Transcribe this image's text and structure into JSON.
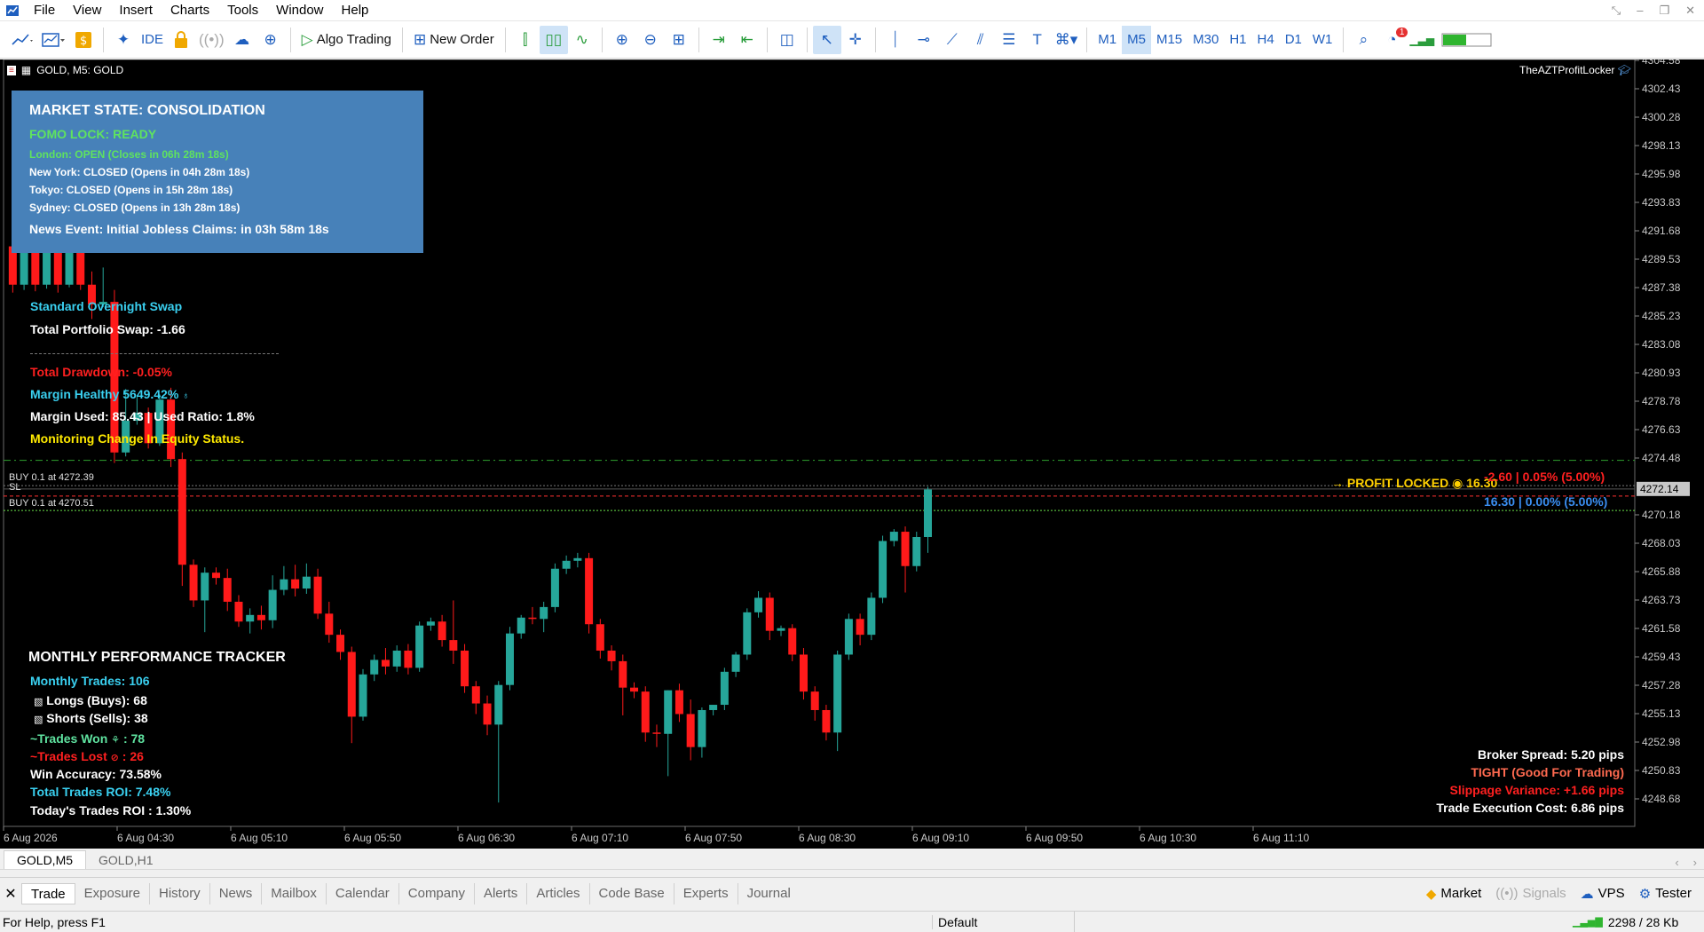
{
  "menu": [
    "File",
    "View",
    "Insert",
    "Charts",
    "Tools",
    "Window",
    "Help"
  ],
  "toolbar": {
    "ide_label": "IDE",
    "algo_label": "Algo Trading",
    "new_order_label": "New Order",
    "timeframes": [
      "M1",
      "M5",
      "M15",
      "M30",
      "H1",
      "H4",
      "D1",
      "W1"
    ],
    "selected_timeframe": "M5",
    "notification_count": "1"
  },
  "chart": {
    "title": "GOLD, M5:  GOLD",
    "ea_name": "TheAZTProfitLocker",
    "price_levels": [
      "4304.58",
      "4302.43",
      "4300.28",
      "4298.13",
      "4295.98",
      "4293.83",
      "4291.68",
      "4289.53",
      "4287.38",
      "4285.23",
      "4283.08",
      "4280.93",
      "4278.78",
      "4276.63",
      "4274.48",
      "4272.14",
      "4270.18",
      "4268.03",
      "4265.88",
      "4263.73",
      "4261.58",
      "4259.43",
      "4257.28",
      "4255.13",
      "4252.98",
      "4250.83",
      "4248.68"
    ],
    "current_price": "4272.14",
    "time_labels": [
      "6 Aug 2026",
      "6 Aug 04:30",
      "6 Aug 05:10",
      "6 Aug 05:50",
      "6 Aug 06:30",
      "6 Aug 07:10",
      "6 Aug 07:50",
      "6 Aug 08:30",
      "6 Aug 09:10",
      "6 Aug 09:50",
      "6 Aug 10:30",
      "6 Aug 11:10"
    ],
    "orders": [
      "BUY 0.1 at 4272.39",
      "SL",
      "BUY 0.1 at 4270.51"
    ],
    "bull_color": "#26a69a",
    "bear_color": "#ff1a1a"
  },
  "market_state": {
    "title": "MARKET STATE: CONSOLIDATION",
    "fomo": "FOMO LOCK: READY",
    "sessions": [
      {
        "text": "London: OPEN (Closes in 06h 28m 18s)",
        "color": "#5fe35f"
      },
      {
        "text": "New York: CLOSED (Opens in 04h 28m 18s)",
        "color": "#ffffff"
      },
      {
        "text": "Tokyo: CLOSED (Opens in 15h 28m 18s)",
        "color": "#ffffff"
      },
      {
        "text": "Sydney: CLOSED (Opens in 13h 28m 18s)",
        "color": "#ffffff"
      }
    ],
    "news": "News Event: Initial Jobless Claims: in 03h 58m 18s"
  },
  "account": {
    "swap_label": "Standard Overnight Swap",
    "total_swap": "Total Portfolio Swap:  -1.66",
    "drawdown": "Total Drawdown: -0.05%",
    "margin_health": "Margin Healthy 5649.42%",
    "margin_used": "Margin Used: 85.43 | Used Ratio: 1.8%",
    "monitoring": "Monitoring Change In Equity Status."
  },
  "profit": {
    "locked_label": "PROFIT LOCKED",
    "locked_value": "16.30",
    "red_line": "-2.60 | 0.05% (5.00%)",
    "blue_line": "16.30 | 0.00% (5.00%)"
  },
  "monthly": {
    "title": "MONTHLY PERFORMANCE TRACKER",
    "trades": "Monthly Trades: 106",
    "longs": "Longs (Buys): 68",
    "shorts": "Shorts (Sells): 38",
    "won": "~Trades Won",
    "won_value": ": 78",
    "lost": "~Trades Lost",
    "lost_value": ": 26",
    "accuracy": "Win Accuracy: 73.58%",
    "roi": "Total Trades ROI: 7.48%",
    "today_roi": "Today's Trades ROI : 1.30%"
  },
  "spread": {
    "broker": "Broker Spread: 5.20 pips",
    "tight": "TIGHT (Good For Trading)",
    "slippage": "Slippage Variance: +1.66 pips",
    "cost": "Trade Execution Cost: 6.86 pips"
  },
  "chart_tabs": [
    "GOLD,M5",
    "GOLD,H1"
  ],
  "toolbox_tabs": [
    "Trade",
    "Exposure",
    "History",
    "News",
    "Mailbox",
    "Calendar",
    "Company",
    "Alerts",
    "Articles",
    "Code Base",
    "Experts",
    "Journal"
  ],
  "toolbox_right": [
    "Market",
    "Signals",
    "VPS",
    "Tester"
  ],
  "status": {
    "help": "For Help, press F1",
    "profile": "Default",
    "traffic": "2298 / 28 Kb"
  },
  "candles": [
    {
      "o": 4290.5,
      "h": 4293.2,
      "c": 4287.6,
      "l": 4287.0
    },
    {
      "o": 4287.6,
      "h": 4290.8,
      "c": 4290.2,
      "l": 4287.2
    },
    {
      "o": 4290.2,
      "h": 4290.6,
      "c": 4287.6,
      "l": 4287.1
    },
    {
      "o": 4287.6,
      "h": 4290.6,
      "c": 4290.1,
      "l": 4287.3
    },
    {
      "o": 4290.1,
      "h": 4291.2,
      "c": 4287.6,
      "l": 4287.0
    },
    {
      "o": 4287.6,
      "h": 4291.0,
      "c": 4290.3,
      "l": 4287.4
    },
    {
      "o": 4290.3,
      "h": 4290.8,
      "c": 4287.6,
      "l": 4287.2
    },
    {
      "o": 4287.6,
      "h": 4288.6,
      "c": 4286.1,
      "l": 4285.0
    },
    {
      "o": 4286.1,
      "h": 4288.9,
      "c": 4286.3,
      "l": 4285.9
    },
    {
      "o": 4286.3,
      "h": 4287.2,
      "c": 4274.9,
      "l": 4274.1
    },
    {
      "o": 4274.9,
      "h": 4279.7,
      "c": 4277.3,
      "l": 4274.6
    },
    {
      "o": 4277.3,
      "h": 4279.2,
      "c": 4277.9,
      "l": 4277.0
    },
    {
      "o": 4277.9,
      "h": 4278.3,
      "c": 4275.6,
      "l": 4275.2
    },
    {
      "o": 4275.6,
      "h": 4279.3,
      "c": 4278.9,
      "l": 4275.4
    },
    {
      "o": 4278.9,
      "h": 4279.8,
      "c": 4274.4,
      "l": 4273.8
    },
    {
      "o": 4274.4,
      "h": 4274.9,
      "c": 4266.4,
      "l": 4264.8
    },
    {
      "o": 4266.4,
      "h": 4266.8,
      "c": 4263.7,
      "l": 4263.2
    },
    {
      "o": 4263.7,
      "h": 4266.2,
      "c": 4265.8,
      "l": 4261.3
    },
    {
      "o": 4265.8,
      "h": 4266.2,
      "c": 4265.4,
      "l": 4264.9
    },
    {
      "o": 4265.4,
      "h": 4266.1,
      "c": 4263.6,
      "l": 4262.9
    },
    {
      "o": 4263.6,
      "h": 4264.1,
      "c": 4262.1,
      "l": 4261.7
    },
    {
      "o": 4262.1,
      "h": 4263.1,
      "c": 4262.6,
      "l": 4261.2
    },
    {
      "o": 4262.6,
      "h": 4263.3,
      "c": 4262.2,
      "l": 4261.5
    },
    {
      "o": 4262.2,
      "h": 4265.6,
      "c": 4264.5,
      "l": 4261.6
    },
    {
      "o": 4264.5,
      "h": 4266.3,
      "c": 4265.3,
      "l": 4264.1
    },
    {
      "o": 4265.3,
      "h": 4266.4,
      "c": 4264.6,
      "l": 4264.0
    },
    {
      "o": 4264.6,
      "h": 4266.5,
      "c": 4265.5,
      "l": 4264.2
    },
    {
      "o": 4265.5,
      "h": 4266.1,
      "c": 4262.7,
      "l": 4262.3
    },
    {
      "o": 4262.7,
      "h": 4263.6,
      "c": 4261.1,
      "l": 4260.5
    },
    {
      "o": 4261.1,
      "h": 4261.5,
      "c": 4259.8,
      "l": 4259.2
    },
    {
      "o": 4259.8,
      "h": 4260.2,
      "c": 4254.9,
      "l": 4252.9
    },
    {
      "o": 4254.9,
      "h": 4258.5,
      "c": 4258.1,
      "l": 4254.6
    },
    {
      "o": 4258.1,
      "h": 4259.6,
      "c": 4259.2,
      "l": 4257.6
    },
    {
      "o": 4259.2,
      "h": 4260.1,
      "c": 4258.7,
      "l": 4258.1
    },
    {
      "o": 4258.7,
      "h": 4260.3,
      "c": 4259.9,
      "l": 4258.3
    },
    {
      "o": 4259.9,
      "h": 4260.4,
      "c": 4258.6,
      "l": 4258.1
    },
    {
      "o": 4258.6,
      "h": 4262.1,
      "c": 4261.8,
      "l": 4258.3
    },
    {
      "o": 4261.8,
      "h": 4262.4,
      "c": 4262.1,
      "l": 4261.4
    },
    {
      "o": 4262.1,
      "h": 4262.6,
      "c": 4260.7,
      "l": 4260.2
    },
    {
      "o": 4260.7,
      "h": 4263.7,
      "c": 4259.9,
      "l": 4258.9
    },
    {
      "o": 4259.9,
      "h": 4260.4,
      "c": 4257.2,
      "l": 4256.7
    },
    {
      "o": 4257.2,
      "h": 4257.6,
      "c": 4255.9,
      "l": 4255.1
    },
    {
      "o": 4255.9,
      "h": 4256.5,
      "c": 4254.3,
      "l": 4253.5
    },
    {
      "o": 4254.3,
      "h": 4257.6,
      "c": 4257.3,
      "l": 4248.4
    },
    {
      "o": 4257.3,
      "h": 4261.7,
      "c": 4261.2,
      "l": 4256.9
    },
    {
      "o": 4261.2,
      "h": 4262.6,
      "c": 4262.4,
      "l": 4260.8
    },
    {
      "o": 4262.4,
      "h": 4263.2,
      "c": 4262.3,
      "l": 4261.9
    },
    {
      "o": 4262.3,
      "h": 4263.6,
      "c": 4263.2,
      "l": 4261.3
    },
    {
      "o": 4263.2,
      "h": 4266.5,
      "c": 4266.1,
      "l": 4262.8
    },
    {
      "o": 4266.1,
      "h": 4267.1,
      "c": 4266.7,
      "l": 4265.7
    },
    {
      "o": 4266.7,
      "h": 4267.3,
      "c": 4266.9,
      "l": 4266.2
    },
    {
      "o": 4266.9,
      "h": 4267.3,
      "c": 4261.9,
      "l": 4261.2
    },
    {
      "o": 4261.9,
      "h": 4262.3,
      "c": 4259.9,
      "l": 4259.3
    },
    {
      "o": 4259.9,
      "h": 4260.3,
      "c": 4259.1,
      "l": 4258.4
    },
    {
      "o": 4259.1,
      "h": 4259.6,
      "c": 4257.1,
      "l": 4255.0
    },
    {
      "o": 4257.1,
      "h": 4257.5,
      "c": 4256.8,
      "l": 4256.3
    },
    {
      "o": 4256.8,
      "h": 4257.2,
      "c": 4253.7,
      "l": 4253.0
    },
    {
      "o": 4253.7,
      "h": 4254.3,
      "c": 4253.6,
      "l": 4252.6
    },
    {
      "o": 4253.6,
      "h": 4255.9,
      "c": 4256.9,
      "l": 4250.4
    },
    {
      "o": 4256.9,
      "h": 4257.4,
      "c": 4255.1,
      "l": 4254.5
    },
    {
      "o": 4255.1,
      "h": 4256.2,
      "c": 4252.6,
      "l": 4251.6
    },
    {
      "o": 4252.6,
      "h": 4255.6,
      "c": 4255.4,
      "l": 4251.8
    },
    {
      "o": 4255.4,
      "h": 4255.8,
      "c": 4255.8,
      "l": 4255.0
    },
    {
      "o": 4255.8,
      "h": 4258.6,
      "c": 4258.3,
      "l": 4255.4
    },
    {
      "o": 4258.3,
      "h": 4259.8,
      "c": 4259.6,
      "l": 4257.9
    },
    {
      "o": 4259.6,
      "h": 4263.1,
      "c": 4262.8,
      "l": 4259.2
    },
    {
      "o": 4262.8,
      "h": 4264.4,
      "c": 4263.9,
      "l": 4262.4
    },
    {
      "o": 4263.9,
      "h": 4264.3,
      "c": 4261.4,
      "l": 4260.7
    },
    {
      "o": 4261.4,
      "h": 4261.8,
      "c": 4261.6,
      "l": 4261.0
    },
    {
      "o": 4261.6,
      "h": 4261.9,
      "c": 4259.6,
      "l": 4259.1
    },
    {
      "o": 4259.6,
      "h": 4260.1,
      "c": 4256.8,
      "l": 4256.2
    },
    {
      "o": 4256.8,
      "h": 4257.2,
      "c": 4255.4,
      "l": 4254.6
    },
    {
      "o": 4255.4,
      "h": 4255.8,
      "c": 4253.7,
      "l": 4253.1
    },
    {
      "o": 4253.7,
      "h": 4259.9,
      "c": 4259.6,
      "l": 4252.3
    },
    {
      "o": 4259.6,
      "h": 4262.7,
      "c": 4262.3,
      "l": 4259.2
    },
    {
      "o": 4262.3,
      "h": 4262.7,
      "c": 4261.1,
      "l": 4260.3
    },
    {
      "o": 4261.1,
      "h": 4264.3,
      "c": 4263.9,
      "l": 4260.7
    },
    {
      "o": 4263.9,
      "h": 4268.6,
      "c": 4268.2,
      "l": 4263.5
    },
    {
      "o": 4268.2,
      "h": 4269.1,
      "c": 4268.9,
      "l": 4267.8
    },
    {
      "o": 4268.9,
      "h": 4269.3,
      "c": 4266.3,
      "l": 4264.3
    },
    {
      "o": 4266.3,
      "h": 4268.9,
      "c": 4268.5,
      "l": 4265.9
    },
    {
      "o": 4268.5,
      "h": 4272.3,
      "c": 4272.1,
      "l": 4267.3
    }
  ]
}
